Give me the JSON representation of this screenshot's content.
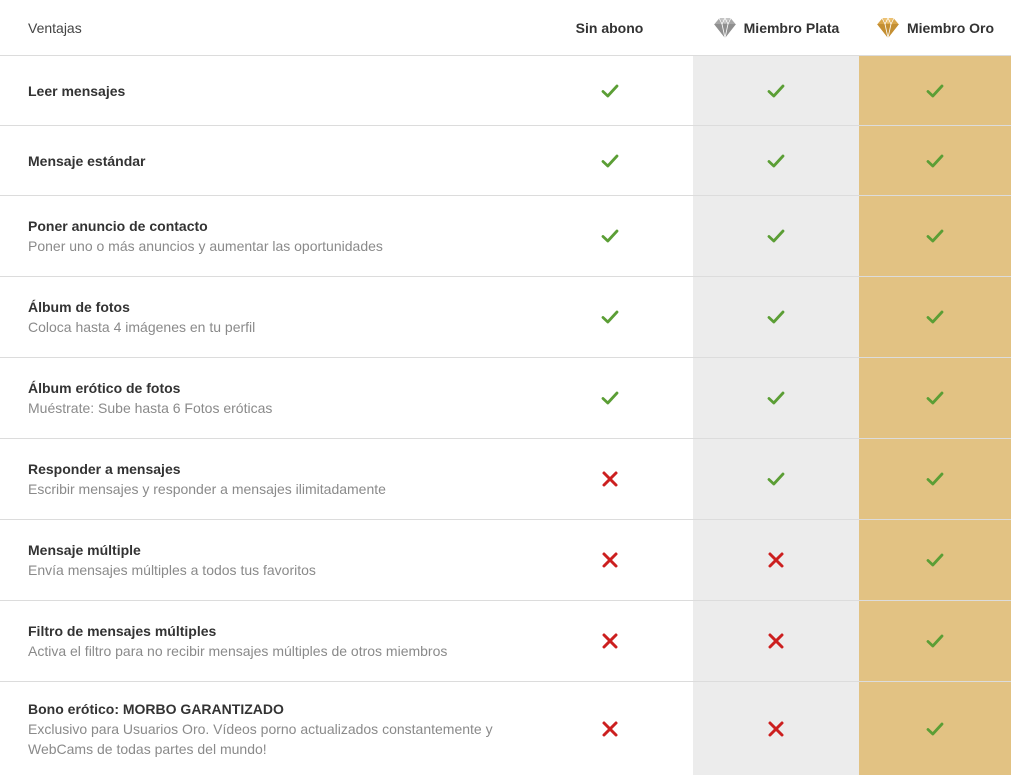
{
  "header": {
    "ventajas": "Ventajas",
    "sin_abono": "Sin abono",
    "plata": "Miembro Plata",
    "oro": "Miembro Oro",
    "plata_icon": "diamond-silver-icon",
    "oro_icon": "diamond-gold-icon"
  },
  "colors": {
    "check": "#5b9e35",
    "cross": "#cc1f1f",
    "plata_bg": "#ececec",
    "oro_bg": "#e2c283",
    "silver_diamond": "#a8a8a8",
    "gold_diamond": "#d9a64a"
  },
  "rows": [
    {
      "title": "Leer mensajes",
      "desc": "",
      "values": [
        true,
        true,
        true
      ]
    },
    {
      "title": "Mensaje estándar",
      "desc": "",
      "values": [
        true,
        true,
        true
      ]
    },
    {
      "title": "Poner anuncio de contacto",
      "desc": "Poner uno o más anuncios y aumentar las oportunidades",
      "values": [
        true,
        true,
        true
      ]
    },
    {
      "title": "Álbum de fotos",
      "desc": "Coloca hasta 4 imágenes en tu perfil",
      "values": [
        true,
        true,
        true
      ]
    },
    {
      "title": "Álbum erótico de fotos",
      "desc": "Muéstrate: Sube hasta 6 Fotos eróticas",
      "values": [
        true,
        true,
        true
      ]
    },
    {
      "title": "Responder a mensajes",
      "desc": "Escribir mensajes y responder a mensajes ilimitadamente",
      "values": [
        false,
        true,
        true
      ]
    },
    {
      "title": "Mensaje múltiple",
      "desc": "Envía mensajes múltiples a todos tus favoritos",
      "values": [
        false,
        false,
        true
      ]
    },
    {
      "title": "Filtro de mensajes múltiples",
      "desc": "Activa el filtro para no recibir mensajes múltiples de otros miembros",
      "values": [
        false,
        false,
        true
      ]
    },
    {
      "title": "Bono erótico: MORBO GARANTIZADO",
      "desc": "Exclusivo para Usuarios Oro. Vídeos porno actualizados constantemente y WebCams de todas partes del mundo!",
      "values": [
        false,
        false,
        true
      ]
    }
  ]
}
